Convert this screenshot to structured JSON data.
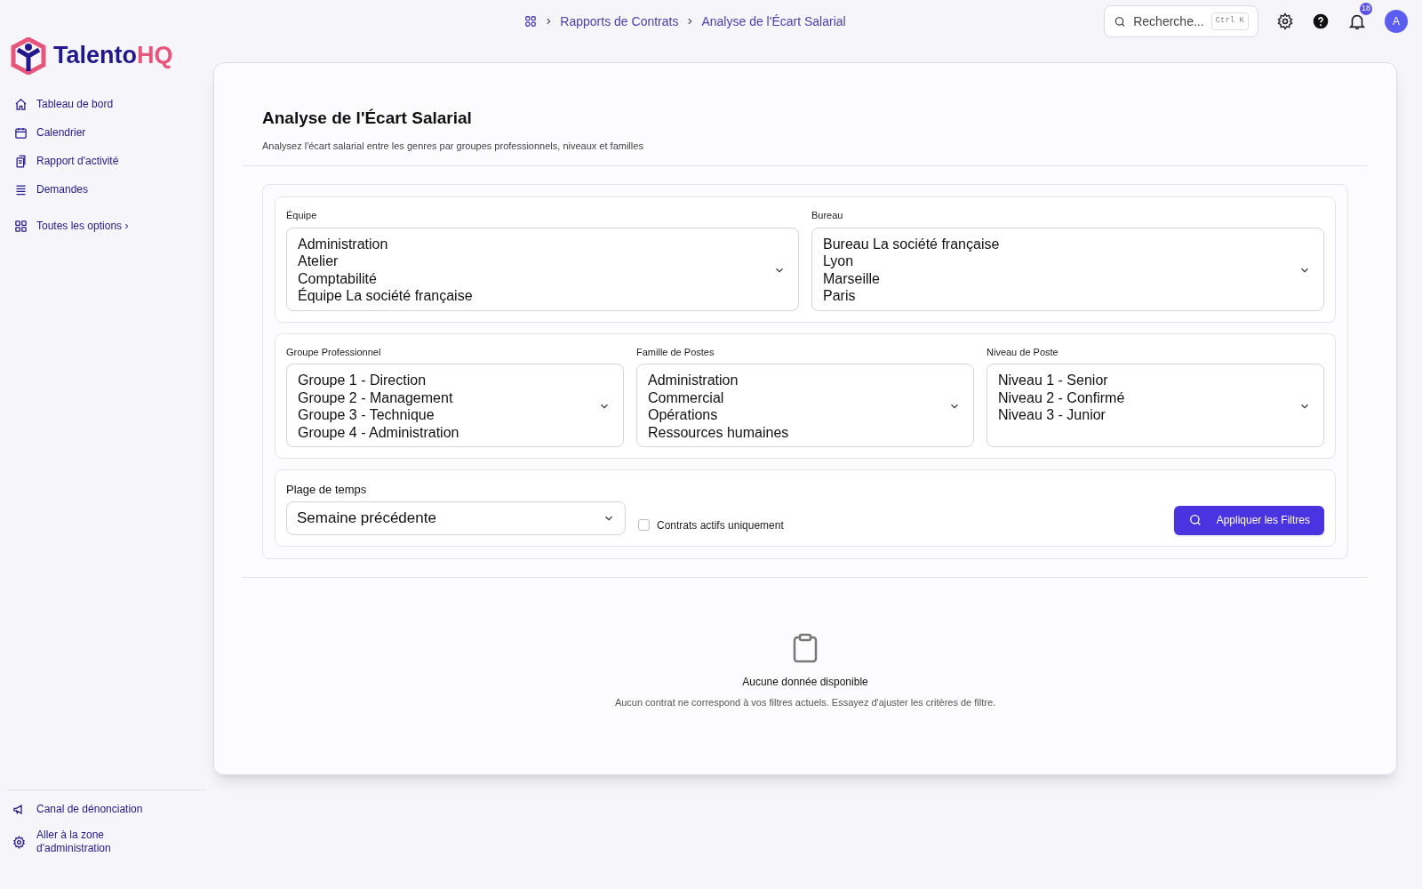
{
  "brand": {
    "name_part_1": "Talento",
    "name_part_2": "HQ"
  },
  "sidebar": {
    "items": [
      {
        "label": "Tableau de bord"
      },
      {
        "label": "Calendrier"
      },
      {
        "label": "Rapport d'activité"
      },
      {
        "label": "Demandes"
      }
    ],
    "all_options": {
      "label": "Toutes les options",
      "chevron": "›"
    },
    "footer_items": [
      {
        "label": "Canal de dénonciation"
      },
      {
        "label": "Aller à la zone d'administration"
      }
    ]
  },
  "breadcrumb": [
    "Rapports de Contrats",
    "Analyse de l'Écart Salarial"
  ],
  "topbar": {
    "search": {
      "placeholder": "Recherche...",
      "shortcut": "Ctrl K"
    },
    "notification_count": "18",
    "avatar": "A"
  },
  "page": {
    "title": "Analyse de l'Écart Salarial",
    "subtitle": "Analysez l'écart salarial entre les genres par groupes professionnels, niveaux et familles"
  },
  "filters": {
    "row_1": [
      {
        "label": "Équipe",
        "options": [
          "Administration",
          "Atelier",
          "Comptabilité",
          "Équipe La société française"
        ]
      },
      {
        "label": "Bureau",
        "options": [
          "Bureau La société française",
          "Lyon",
          "Marseille",
          "Paris"
        ]
      }
    ],
    "row_2": [
      {
        "label": "Groupe Professionnel",
        "options": [
          "Groupe 1 - Direction",
          "Groupe 2 - Management",
          "Groupe 3 - Technique",
          "Groupe 4 - Administration"
        ]
      },
      {
        "label": "Famille de Postes",
        "options": [
          "Administration",
          "Commercial",
          "Opérations",
          "Ressources humaines"
        ]
      },
      {
        "label": "Niveau de Poste",
        "options": [
          "Niveau 1 - Senior",
          "Niveau 2 - Confirmé",
          "Niveau 3 - Junior"
        ]
      }
    ],
    "time_range": {
      "label": "Plage de temps",
      "value": "Semaine précédente"
    },
    "active_only": {
      "label": "Contrats actifs uniquement",
      "checked": false
    },
    "apply_button": "Appliquer les Filtres"
  },
  "empty_state": {
    "title": "Aucune donnée disponible",
    "message": "Aucun contrat ne correspond à vos filtres actuels. Essayez d'ajuster les critères de filtre."
  }
}
